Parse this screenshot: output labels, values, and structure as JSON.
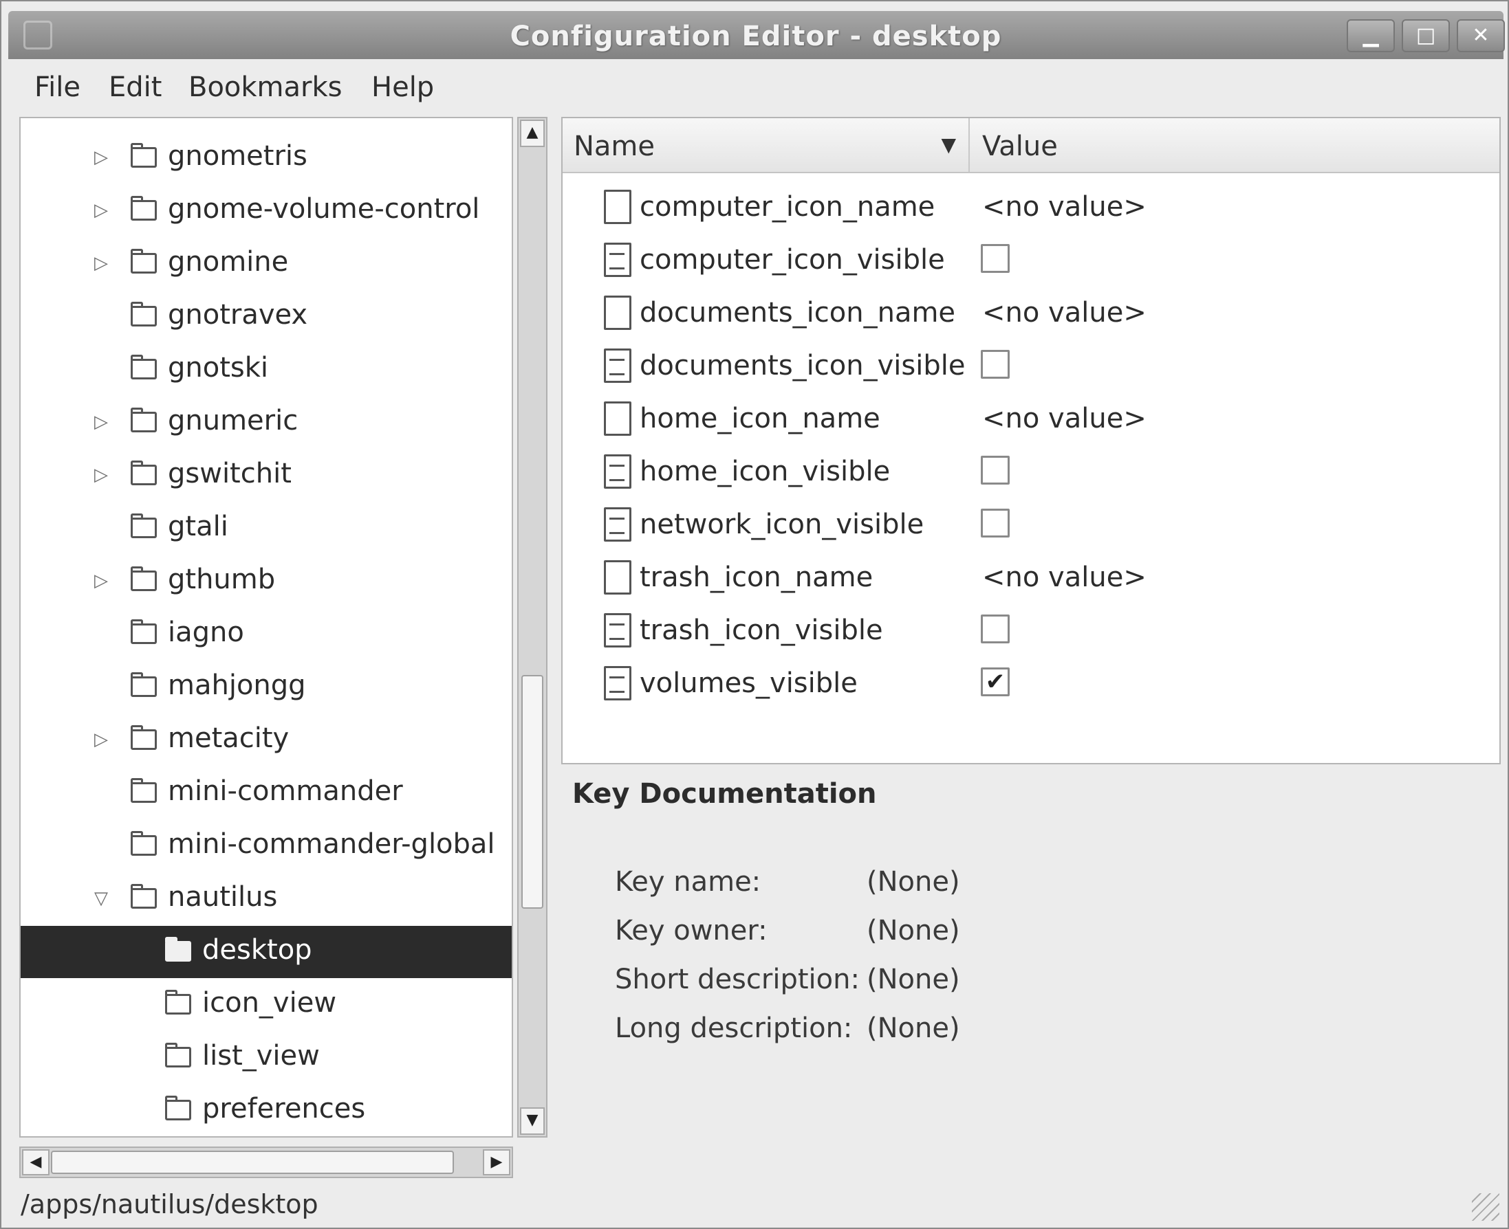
{
  "window": {
    "title": "Configuration Editor - desktop",
    "buttons": {
      "minimize": "▁",
      "maximize": "□",
      "close": "✕"
    }
  },
  "menubar": {
    "items": [
      "File",
      "Edit",
      "Bookmarks",
      "Help"
    ]
  },
  "tree": {
    "items": [
      {
        "label": "gnometris",
        "expandable": true,
        "indent": 0
      },
      {
        "label": "gnome-volume-control",
        "expandable": true,
        "indent": 0
      },
      {
        "label": "gnomine",
        "expandable": true,
        "indent": 0
      },
      {
        "label": "gnotravex",
        "expandable": false,
        "indent": 0
      },
      {
        "label": "gnotski",
        "expandable": false,
        "indent": 0
      },
      {
        "label": "gnumeric",
        "expandable": true,
        "indent": 0
      },
      {
        "label": "gswitchit",
        "expandable": true,
        "indent": 0
      },
      {
        "label": "gtali",
        "expandable": false,
        "indent": 0
      },
      {
        "label": "gthumb",
        "expandable": true,
        "indent": 0
      },
      {
        "label": "iagno",
        "expandable": false,
        "indent": 0
      },
      {
        "label": "mahjongg",
        "expandable": false,
        "indent": 0
      },
      {
        "label": "metacity",
        "expandable": true,
        "indent": 0
      },
      {
        "label": "mini-commander",
        "expandable": false,
        "indent": 0
      },
      {
        "label": "mini-commander-global",
        "expandable": false,
        "indent": 0
      },
      {
        "label": "nautilus",
        "expandable": true,
        "expanded": true,
        "indent": 0
      },
      {
        "label": "desktop",
        "expandable": false,
        "indent": 1,
        "selected": true
      },
      {
        "label": "icon_view",
        "expandable": false,
        "indent": 1
      },
      {
        "label": "list_view",
        "expandable": false,
        "indent": 1
      },
      {
        "label": "preferences",
        "expandable": false,
        "indent": 1
      }
    ]
  },
  "list": {
    "columns": {
      "name": "Name",
      "value": "Value"
    },
    "rows": [
      {
        "key": "computer_icon_name",
        "type": "string",
        "value": "<no value>"
      },
      {
        "key": "computer_icon_visible",
        "type": "bool",
        "checked": false
      },
      {
        "key": "documents_icon_name",
        "type": "string",
        "value": "<no value>"
      },
      {
        "key": "documents_icon_visible",
        "type": "bool",
        "checked": false
      },
      {
        "key": "home_icon_name",
        "type": "string",
        "value": "<no value>"
      },
      {
        "key": "home_icon_visible",
        "type": "bool",
        "checked": false
      },
      {
        "key": "network_icon_visible",
        "type": "bool",
        "checked": false
      },
      {
        "key": "trash_icon_name",
        "type": "string",
        "value": "<no value>"
      },
      {
        "key": "trash_icon_visible",
        "type": "bool",
        "checked": false
      },
      {
        "key": "volumes_visible",
        "type": "bool",
        "checked": true
      }
    ]
  },
  "documentation": {
    "title": "Key Documentation",
    "fields": [
      {
        "label": "Key name:",
        "value": "(None)"
      },
      {
        "label": "Key owner:",
        "value": "(None)"
      },
      {
        "label": "Short description:",
        "value": "(None)"
      },
      {
        "label": "Long description:",
        "value": "(None)"
      }
    ]
  },
  "statusbar": {
    "path": "/apps/nautilus/desktop"
  }
}
